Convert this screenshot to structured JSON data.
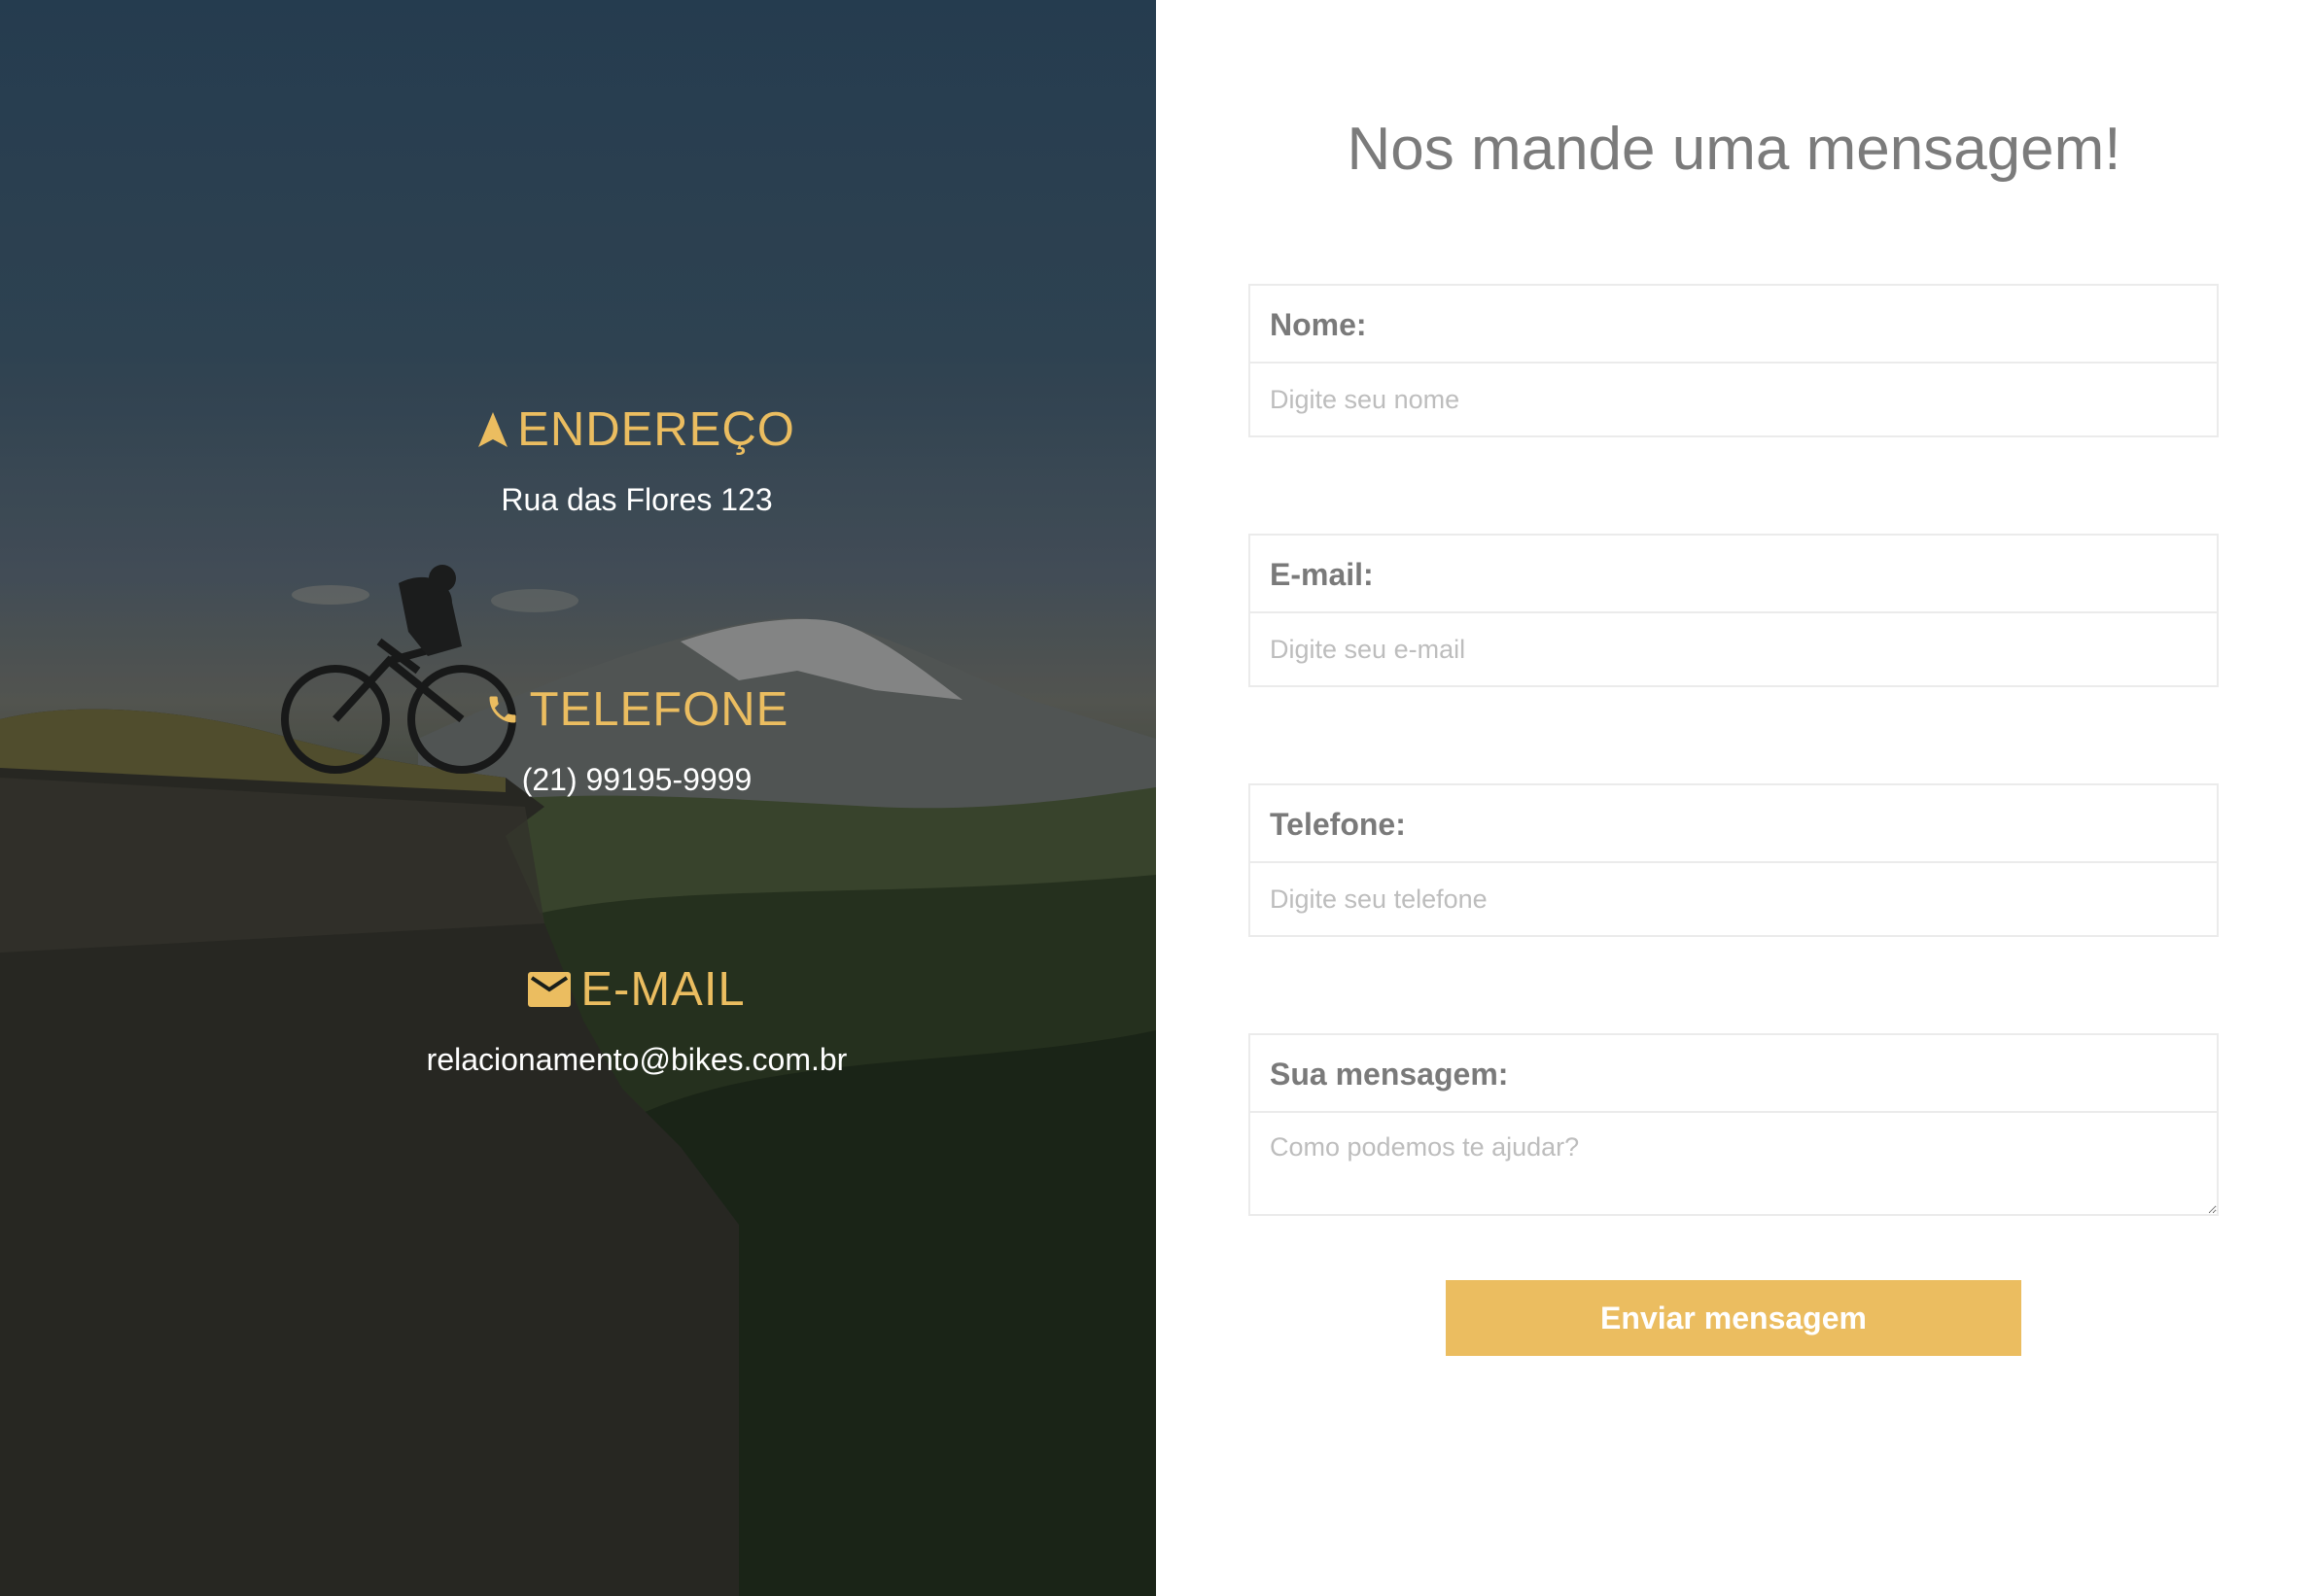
{
  "colors": {
    "accent": "#ebbd60",
    "heading": "#7b7b7b",
    "label": "#7a7a7a",
    "placeholder": "#bdbdbd",
    "border": "#ebebeb"
  },
  "contact": {
    "address": {
      "icon": "navigation-arrow-icon",
      "title": "ENDEREÇO",
      "value": "Rua das Flores 123"
    },
    "phone": {
      "icon": "phone-icon",
      "title": "TELEFONE",
      "value": "(21) 99195-9999"
    },
    "email": {
      "icon": "envelope-icon",
      "title": "E-MAIL",
      "value": "relacionamento@bikes.com.br"
    }
  },
  "form": {
    "heading": "Nos mande uma mensagem!",
    "name": {
      "label": "Nome:",
      "placeholder": "Digite seu nome",
      "value": ""
    },
    "email": {
      "label": "E-mail:",
      "placeholder": "Digite seu e-mail",
      "value": ""
    },
    "phone": {
      "label": "Telefone:",
      "placeholder": "Digite seu telefone",
      "value": ""
    },
    "message": {
      "label": "Sua mensagem:",
      "placeholder": "Como podemos te ajudar?",
      "value": ""
    },
    "submit_label": "Enviar mensagem"
  }
}
